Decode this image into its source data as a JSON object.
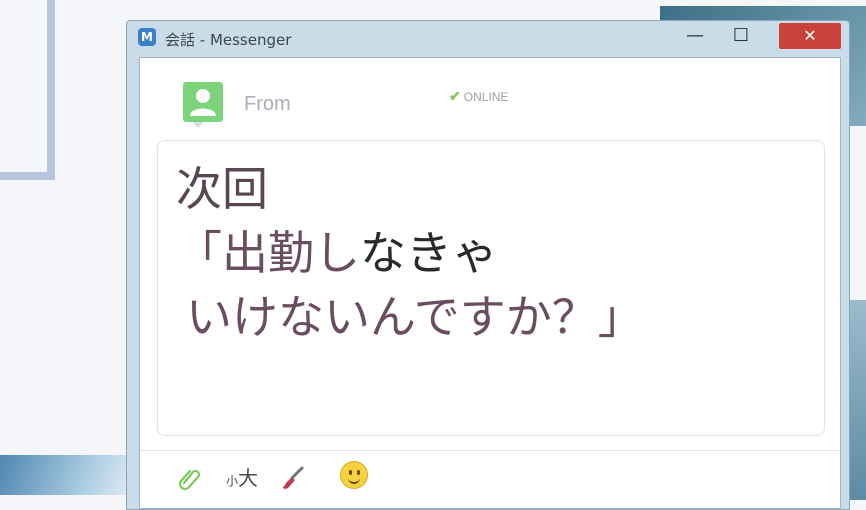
{
  "window": {
    "title": "会話 - Messenger",
    "app_icon": "M",
    "minimize_glyph": "—",
    "maximize_glyph": "☐",
    "close_glyph": "✕"
  },
  "header": {
    "from_label": "From",
    "status": "ONLINE",
    "status_icon": "check-icon",
    "avatar_icon": "user-avatar-icon"
  },
  "message": {
    "line1": "次回",
    "line2_part1": "「出勤し",
    "line2_part2": "なきゃ",
    "line3": "いけないんですか？」"
  },
  "toolbar": {
    "attach_icon": "paperclip-icon",
    "font_size_small": "小",
    "font_size_large": "大",
    "brush_icon": "paintbrush-icon",
    "emoji_icon": "smiley-icon"
  },
  "colors": {
    "accent_green": "#7cc95b",
    "close_red": "#c8443a",
    "message_text": "#6b4d62"
  }
}
